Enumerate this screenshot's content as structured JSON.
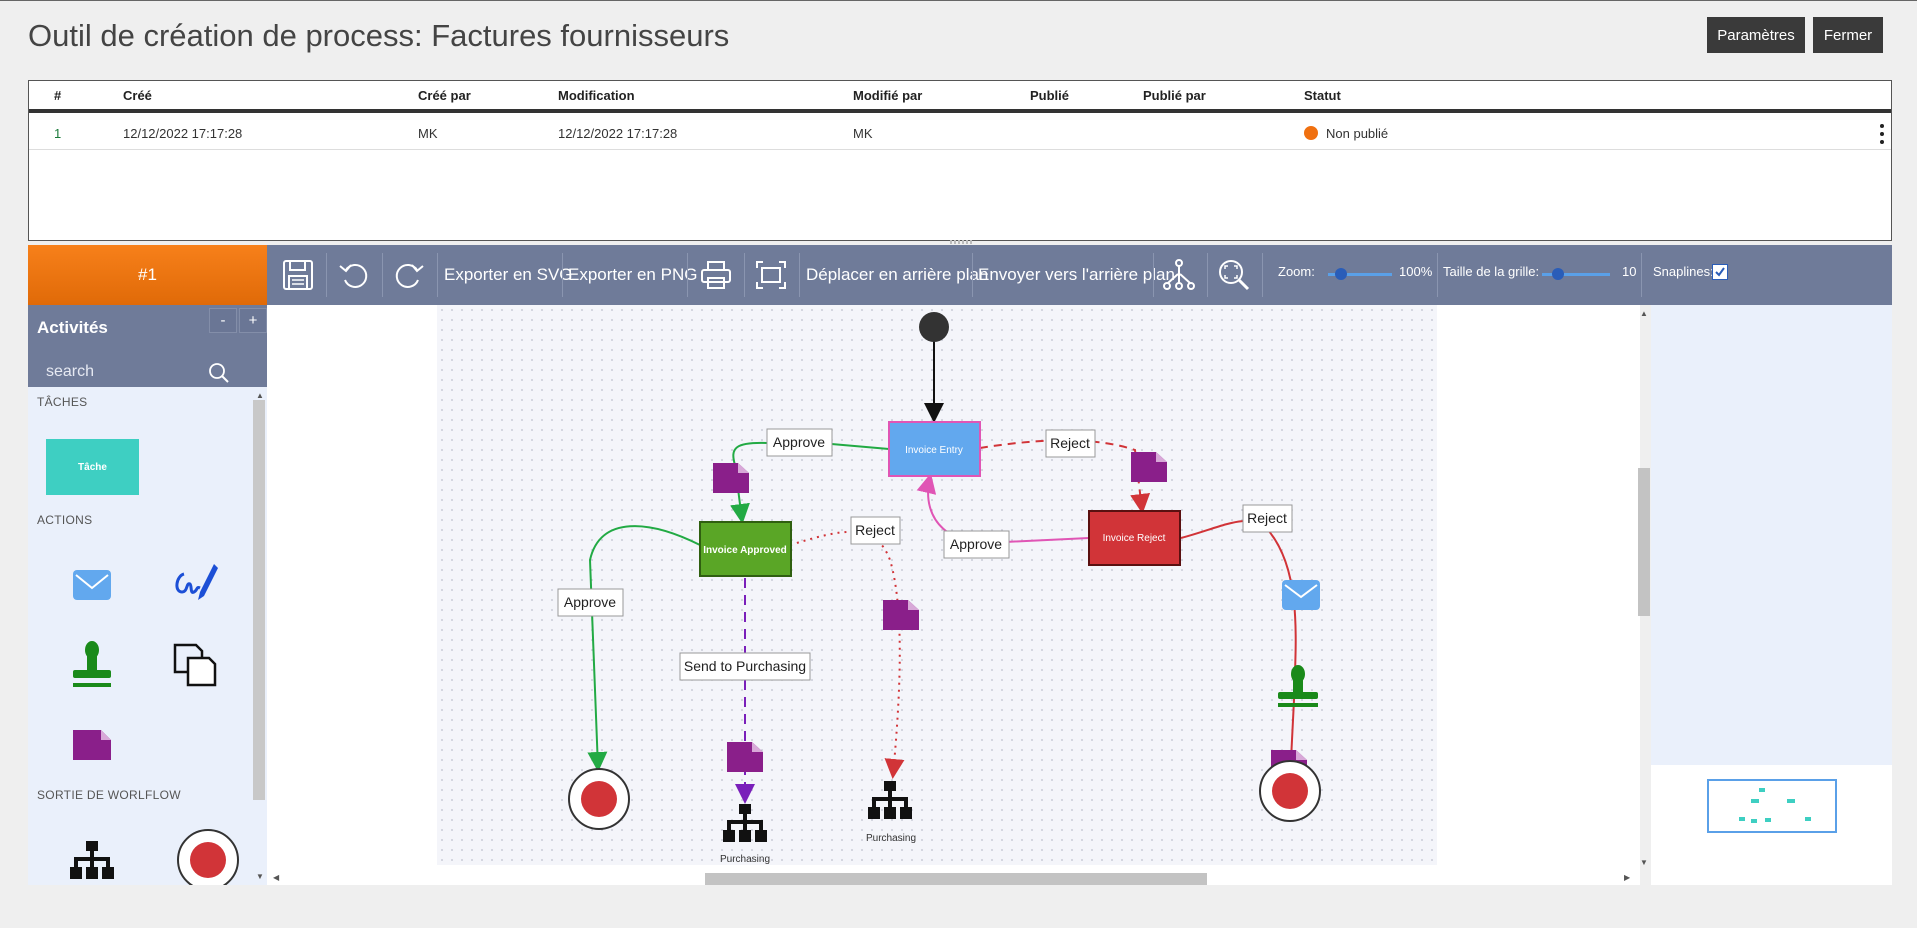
{
  "page": {
    "title": "Outil de création de process: Factures fournisseurs",
    "params_button": "Paramètres",
    "close_button": "Fermer"
  },
  "versions": {
    "columns": [
      "#",
      "Créé",
      "Créé par",
      "Modification",
      "Modifié par",
      "Publié",
      "Publié par",
      "Statut"
    ],
    "rows": [
      {
        "num": "1",
        "created": "12/12/2022 17:17:28",
        "created_by": "MK",
        "modified": "12/12/2022 17:17:28",
        "modified_by": "MK",
        "published": "",
        "published_by": "",
        "status": "Non publié",
        "status_color": "#f07010"
      }
    ]
  },
  "editor": {
    "version_tab": "#1",
    "toolbar": {
      "export_svg": "Exporter en SVG",
      "export_png": "Exporter en PNG",
      "move_back": "Déplacer en arrière plan",
      "send_back": "Envoyer vers l'arrière plan",
      "zoom_label": "Zoom:",
      "zoom_value": "100%",
      "grid_label": "Taille de la grille:",
      "grid_value": "10",
      "snaplines_label": "Snaplines:"
    },
    "palette": {
      "title": "Activités",
      "collapse": "-",
      "expand": "+",
      "search_placeholder": "search",
      "section_tasks": "TÂCHES",
      "task_label": "Tâche",
      "section_actions": "ACTIONS",
      "section_exit": "SORTIE DE WORLFLOW"
    },
    "diagram": {
      "nodes": {
        "invoice_entry": "Invoice Entry",
        "invoice_approved": "Invoice Approved",
        "invoice_reject": "Invoice Reject",
        "purchasing_1": "Purchasing",
        "purchasing_2": "Purchasing"
      },
      "edges": {
        "approve_1": "Approve",
        "reject_1": "Reject",
        "reject_2": "Reject",
        "approve_2": "Approve",
        "approve_3": "Approve",
        "send_purchasing": "Send to Purchasing",
        "reject_3": "Reject"
      }
    },
    "colors": {
      "accent": "#f07010",
      "toolbar": "#6f7b99",
      "task": "#3ecfc2",
      "entry": "#62a8ee",
      "approved": "#5aa626",
      "reject": "#d13438",
      "document": "#8a1f8a"
    }
  }
}
